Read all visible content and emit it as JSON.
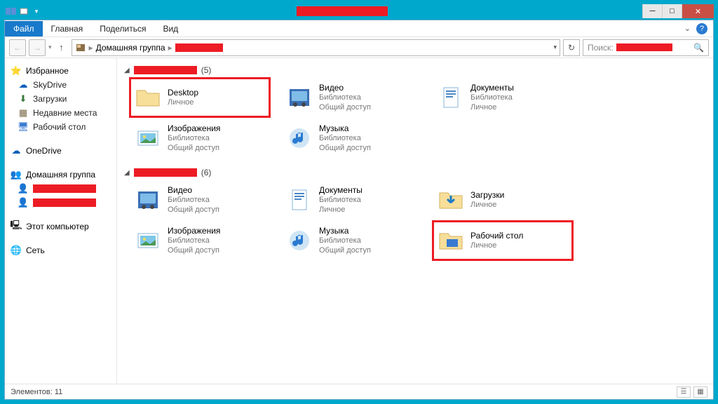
{
  "title_redacted": true,
  "ribbon": {
    "file": "Файл",
    "tabs": [
      "Главная",
      "Поделиться",
      "Вид"
    ]
  },
  "address": {
    "root": "Домашняя группа",
    "trail_redacted": true
  },
  "search": {
    "label": "Поиск:",
    "redacted": true
  },
  "nav": {
    "favorites": {
      "label": "Избранное",
      "items": [
        "SkyDrive",
        "Загрузки",
        "Недавние места",
        "Рабочий стол"
      ]
    },
    "onedrive": "OneDrive",
    "homegroup": {
      "label": "Домашняя группа",
      "users_redacted": 2
    },
    "thispc": "Этот компьютер",
    "network": "Сеть"
  },
  "groups": [
    {
      "count": "(5)",
      "items": [
        {
          "title": "Desktop",
          "sub1": "Личное",
          "sub2": "",
          "icon": "folder",
          "hl": true
        },
        {
          "title": "Видео",
          "sub1": "Библиотека",
          "sub2": "Общий доступ",
          "icon": "video"
        },
        {
          "title": "Документы",
          "sub1": "Библиотека",
          "sub2": "Личное",
          "icon": "doc"
        },
        {
          "title": "Изображения",
          "sub1": "Библиотека",
          "sub2": "Общий доступ",
          "icon": "image"
        },
        {
          "title": "Музыка",
          "sub1": "Библиотека",
          "sub2": "Общий доступ",
          "icon": "music"
        }
      ]
    },
    {
      "count": "(6)",
      "items": [
        {
          "title": "Видео",
          "sub1": "Библиотека",
          "sub2": "Общий доступ",
          "icon": "video"
        },
        {
          "title": "Документы",
          "sub1": "Библиотека",
          "sub2": "Личное",
          "icon": "doc"
        },
        {
          "title": "Загрузки",
          "sub1": "Личное",
          "sub2": "",
          "icon": "downloads"
        },
        {
          "title": "Изображения",
          "sub1": "Библиотека",
          "sub2": "Общий доступ",
          "icon": "image"
        },
        {
          "title": "Музыка",
          "sub1": "Библиотека",
          "sub2": "Общий доступ",
          "icon": "music"
        },
        {
          "title": "Рабочий стол",
          "sub1": "Личное",
          "sub2": "",
          "icon": "desktop",
          "hl": true
        }
      ]
    }
  ],
  "status": {
    "label": "Элементов:",
    "count": "11"
  }
}
